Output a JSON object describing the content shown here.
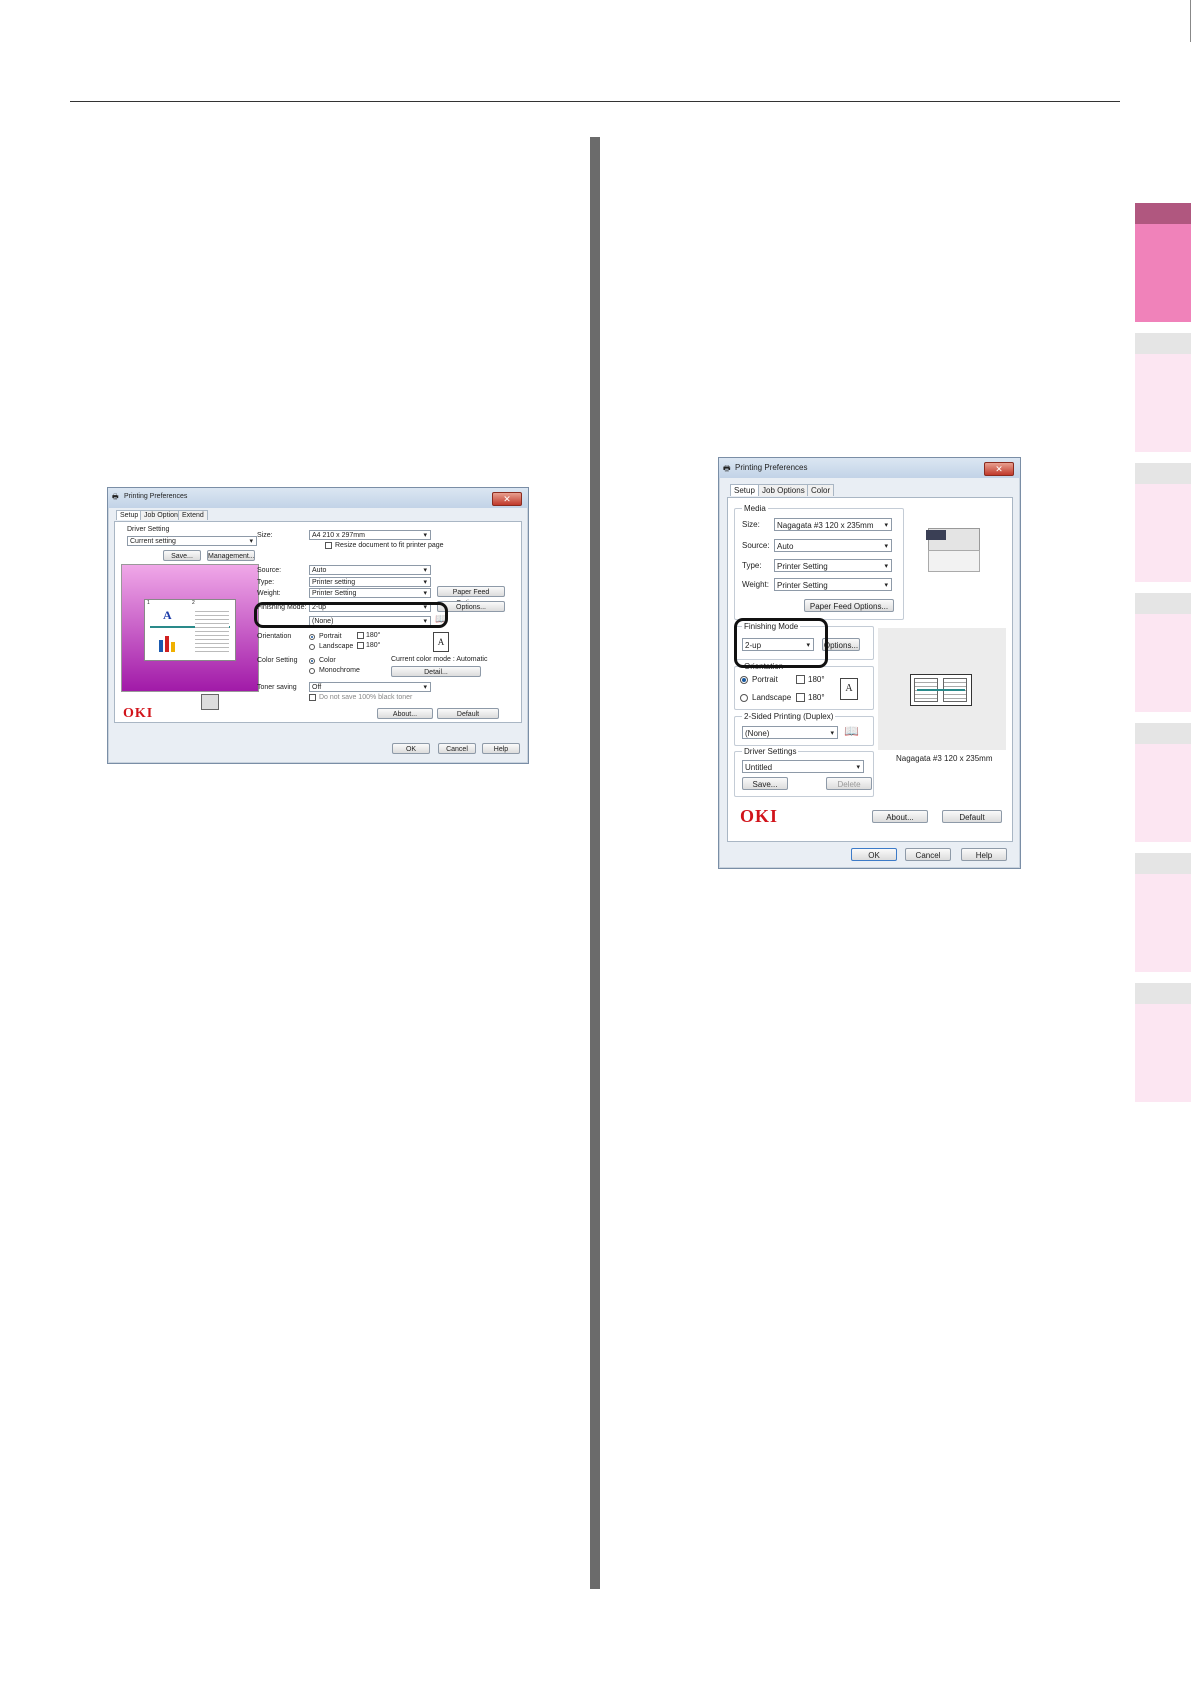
{
  "left_dialog": {
    "title": "Printing Preferences",
    "close": "✕",
    "tabs": [
      "Setup",
      "Job Options",
      "Extend"
    ],
    "driver_setting_label": "Driver Setting",
    "driver_setting_value": "Current setting",
    "save_button": "Save...",
    "management_button": "Management...",
    "size_label": "Size:",
    "size_value": "A4 210 x 297mm",
    "resize_checkbox": "Resize document to fit printer page",
    "source_label": "Source:",
    "source_value": "Auto",
    "type_label": "Type:",
    "type_value": "Printer setting",
    "weight_label": "Weight:",
    "weight_value": "Printer Setting",
    "paper_feed_button": "Paper Feed Options...",
    "finishing_label": "Finishing Mode:",
    "finishing_value": "2-up",
    "options_button": "Options...",
    "duplex_value": "(None)",
    "orientation_label": "Orientation",
    "portrait": "Portrait",
    "landscape": "Landscape",
    "rot180": "180°",
    "color_setting_label": "Color Setting",
    "color": "Color",
    "monochrome": "Monochrome",
    "color_mode_text": "Current color mode : Automatic",
    "detail_button": "Detail...",
    "toner_label": "Toner saving",
    "toner_value": "Off",
    "toner_checkbox": "Do not save 100% black toner",
    "logo": "OKI",
    "about_button": "About...",
    "default_button": "Default",
    "ok_button": "OK",
    "cancel_button": "Cancel",
    "help_button": "Help",
    "preview_letter": "A",
    "preview_page1": "1",
    "preview_page2": "2"
  },
  "right_dialog": {
    "title": "Printing Preferences",
    "close": "✕",
    "tabs": [
      "Setup",
      "Job Options",
      "Color"
    ],
    "media_label": "Media",
    "size_label": "Size:",
    "size_value": "Nagagata #3 120 x 235mm",
    "source_label": "Source:",
    "source_value": "Auto",
    "type_label": "Type:",
    "type_value": "Printer Setting",
    "weight_label": "Weight:",
    "weight_value": "Printer Setting",
    "paper_feed_button": "Paper Feed Options...",
    "finishing_label": "Finishing Mode",
    "finishing_value": "2-up",
    "options_button": "Options...",
    "orientation_label": "Orientation",
    "portrait": "Portrait",
    "landscape": "Landscape",
    "rot180": "180°",
    "duplex_label": "2-Sided Printing (Duplex)",
    "duplex_value": "(None)",
    "driver_settings_label": "Driver Settings",
    "driver_settings_value": "Untitled",
    "save_button": "Save...",
    "delete_button": "Delete",
    "preview_caption": "Nagagata #3 120 x 235mm",
    "logo": "OKI",
    "about_button": "About...",
    "default_button": "Default",
    "ok_button": "OK",
    "cancel_button": "Cancel",
    "help_button": "Help",
    "preview_letter": "A"
  },
  "colors": {
    "side_tab_active_cap": "#b0577f",
    "side_tab_active": "#f082ba",
    "side_tab_cap": "#e5e5e5",
    "side_tab": "#fce6f2",
    "preview_top": "#f0a8e8",
    "preview_bottom": "#a11aa8",
    "oki_red": "#d1141b"
  }
}
